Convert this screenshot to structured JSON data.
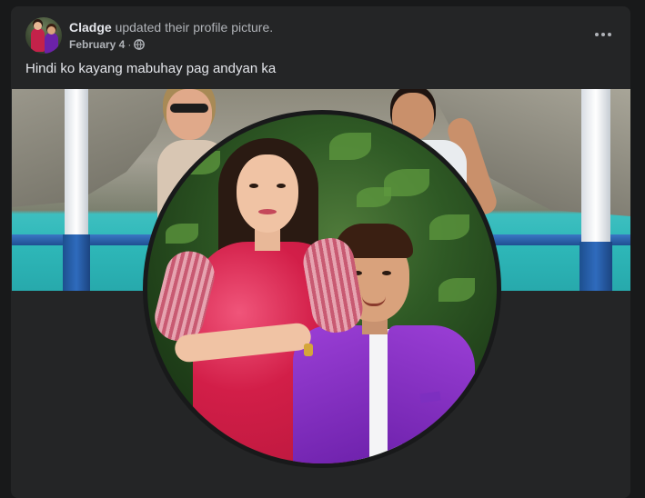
{
  "post": {
    "author": "Cladge",
    "action": " updated their profile picture.",
    "date": "February 4",
    "separator": " · ",
    "audience_icon": "globe-icon",
    "more_icon": "more-options-icon",
    "caption": "Hindi ko kayang mabuhay pag andyan ka"
  },
  "colors": {
    "page_bg": "#18191a",
    "card_bg": "#242526",
    "primary_text": "#e4e6eb",
    "secondary_text": "#b0b3b8"
  }
}
